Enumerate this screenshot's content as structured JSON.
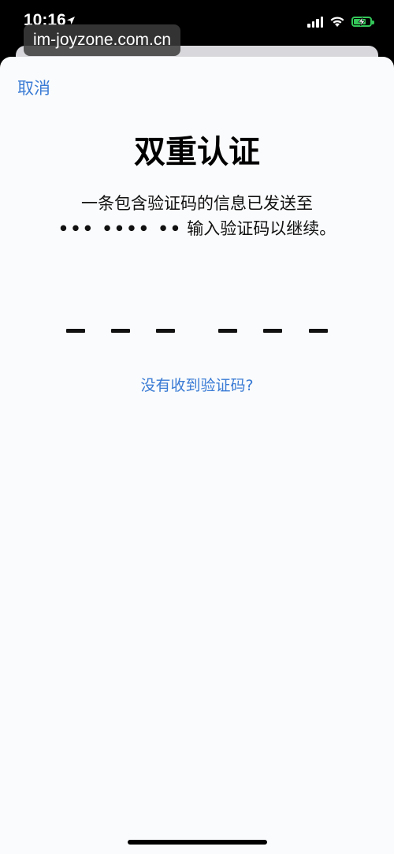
{
  "status_bar": {
    "time": "10:16",
    "location_icon": "location-arrow-icon",
    "signal_icon": "cellular-signal-icon",
    "wifi_icon": "wifi-icon",
    "battery_icon": "battery-charging-icon",
    "battery_level": 0.8,
    "battery_color": "#34c759"
  },
  "watermark": {
    "text": "im-joyzone.com.cn"
  },
  "sheet": {
    "cancel_label": "取消",
    "title": "双重认证",
    "message_line1": "一条包含验证码的信息已发送至",
    "masked_number": "••• •••• ••",
    "message_line2_suffix": "输入验证码以继续。",
    "code_length": 6,
    "no_code_link": "没有收到验证码?"
  },
  "colors": {
    "accent": "#3a7bd5",
    "sheet_background": "#fafbfc",
    "screen_background": "#000000"
  }
}
